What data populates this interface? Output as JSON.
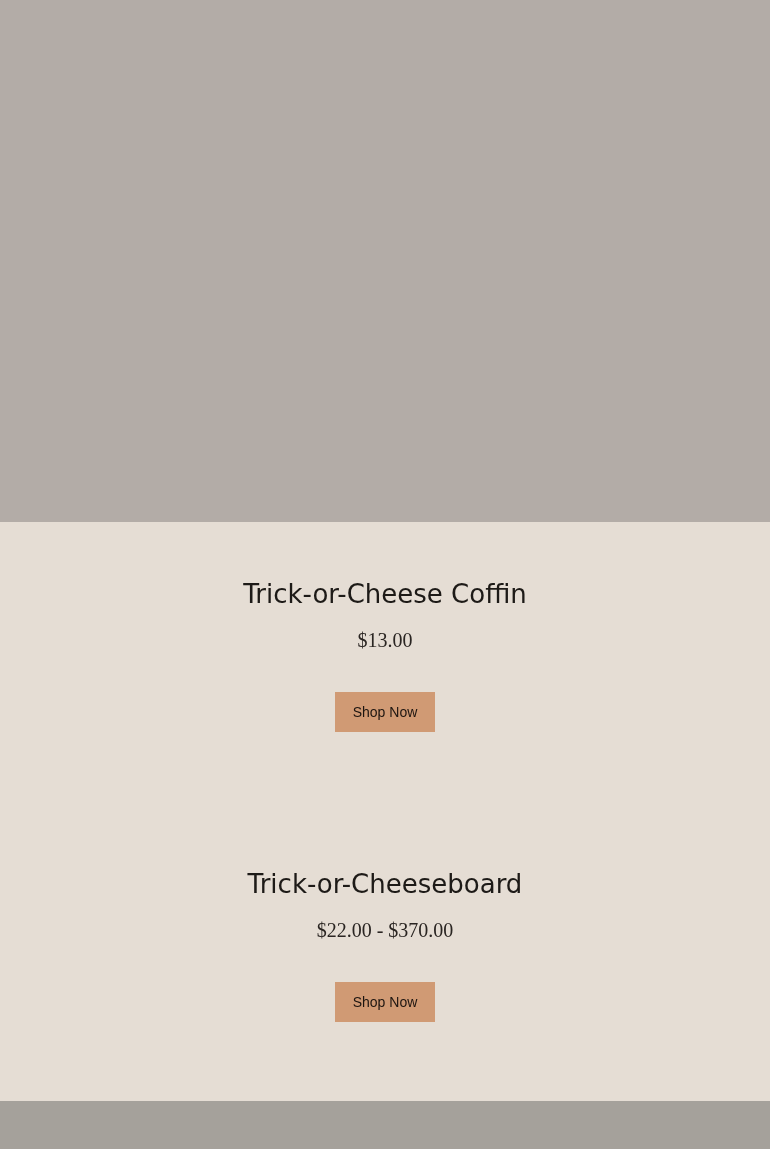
{
  "products": [
    {
      "title": "Trick-or-Cheese Coffin",
      "price": "$13.00",
      "button": "Shop Now"
    },
    {
      "title": "Trick-or-Cheeseboard",
      "price": "$22.00 - $370.00",
      "button": "Shop Now"
    }
  ]
}
